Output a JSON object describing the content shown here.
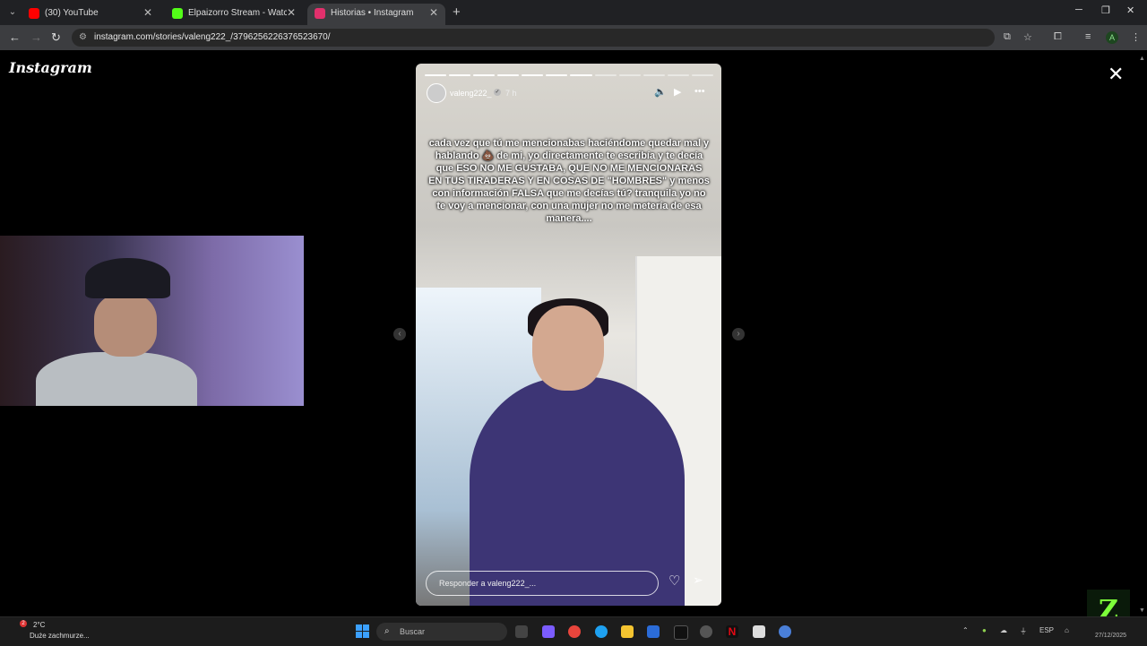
{
  "browser": {
    "tabs": [
      {
        "title": "(30) YouTube",
        "color": "#ff0000",
        "active": false
      },
      {
        "title": "Elpaizorro Stream - Watch Live",
        "color": "#53fc18",
        "active": false
      },
      {
        "title": "Historias • Instagram",
        "color": "#e1306c",
        "active": true
      }
    ],
    "new_tab": "+",
    "url": "instagram.com/stories/valeng222_/3796256226376523670/",
    "profile_initial": "A"
  },
  "page": {
    "logo": "Instagram",
    "close": "✕"
  },
  "story": {
    "segments_total": 12,
    "segments_done": 7,
    "username": "valeng222_",
    "time_ago": "7 h",
    "caption": "cada vez que tú me mencionabas haciéndome quedar mal y hablando 💩 de mi, yo directamente te escribía y te decía que ESO NO ME GUSTABA, QUE NO ME MENCIONARAS EN TUS TIRADERAS Y EN COSAS DE \"HOMBRES\" y menos con información FALSA que me decías tú? tranquila yo no te voy a mencionar, con una mujer no me metería de esa manera....",
    "reply_placeholder": "Responder a valeng222_..."
  },
  "taskbar": {
    "weather_temp": "2°C",
    "weather_desc": "Duże zachmurze...",
    "notification_count": "2",
    "search_placeholder": "Buscar",
    "language": "ESP",
    "date": "27/12/2025"
  }
}
